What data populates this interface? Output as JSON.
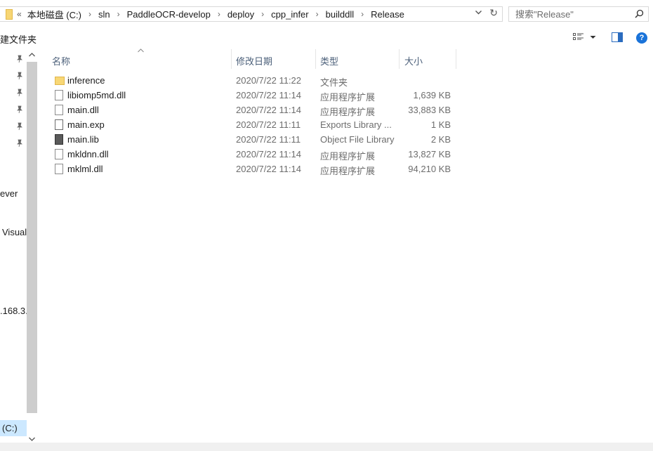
{
  "address": {
    "overflow": "«",
    "crumbs": [
      "本地磁盘 (C:)",
      "sln",
      "PaddleOCR-develop",
      "deploy",
      "cpp_infer",
      "builddll",
      "Release"
    ],
    "separator": "›",
    "dropdown_icon": "chevron-down-icon",
    "refresh_icon": "refresh-icon"
  },
  "search": {
    "placeholder": "搜索\"Release\""
  },
  "command": {
    "new_folder": "建文件夹"
  },
  "columns": {
    "name": "名称",
    "date": "修改日期",
    "type": "类型",
    "size": "大小"
  },
  "nav": {
    "labels": [
      "ever",
      "Visual",
      ".168.3.",
      "(C:)"
    ]
  },
  "files": [
    {
      "name": "inference",
      "date": "2020/7/22 11:22",
      "type": "文件夹",
      "size": "",
      "icon": "folder-icon"
    },
    {
      "name": "libiomp5md.dll",
      "date": "2020/7/22 11:14",
      "type": "应用程序扩展",
      "size": "1,639 KB",
      "icon": "dll-file-icon"
    },
    {
      "name": "main.dll",
      "date": "2020/7/22 11:14",
      "type": "应用程序扩展",
      "size": "33,883 KB",
      "icon": "dll-file-icon"
    },
    {
      "name": "main.exp",
      "date": "2020/7/22 11:11",
      "type": "Exports Library ...",
      "size": "1 KB",
      "icon": "exp-file-icon"
    },
    {
      "name": "main.lib",
      "date": "2020/7/22 11:11",
      "type": "Object File Library",
      "size": "2 KB",
      "icon": "lib-file-icon"
    },
    {
      "name": "mkldnn.dll",
      "date": "2020/7/22 11:14",
      "type": "应用程序扩展",
      "size": "13,827 KB",
      "icon": "dll-file-icon"
    },
    {
      "name": "mklml.dll",
      "date": "2020/7/22 11:14",
      "type": "应用程序扩展",
      "size": "94,210 KB",
      "icon": "dll-file-icon"
    }
  ],
  "colors": {
    "accent": "#1a73d9",
    "folder": "#f8d775",
    "selection": "#cce8ff",
    "header_text": "#4c607a"
  }
}
